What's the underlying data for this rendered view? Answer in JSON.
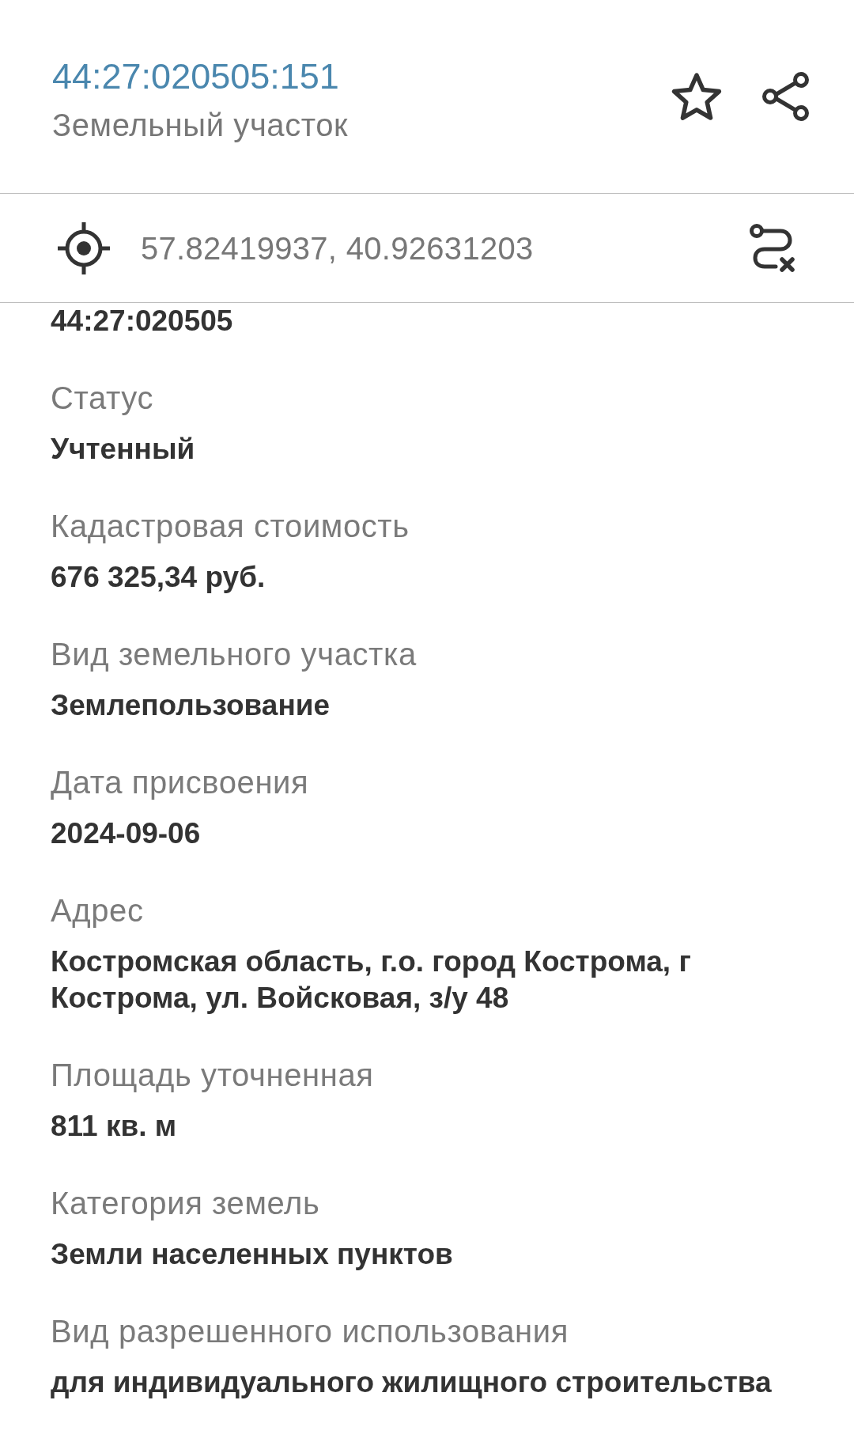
{
  "header": {
    "title": "44:27:020505:151",
    "subtitle": "Земельный участок"
  },
  "location": {
    "coordinates": "57.82419937, 40.92631203"
  },
  "fields": [
    {
      "value": "44:27:020505"
    },
    {
      "label": "Статус",
      "value": "Учтенный"
    },
    {
      "label": "Кадастровая стоимость",
      "value": "676 325,34 руб."
    },
    {
      "label": "Вид земельного участка",
      "value": "Землепользование"
    },
    {
      "label": "Дата присвоения",
      "value": "2024-09-06"
    },
    {
      "label": "Адрес",
      "value": "Костромская область, г.о. город Кострома, г Кострома, ул. Войсковая, з/у 48"
    },
    {
      "label": "Площадь уточненная",
      "value": "811 кв. м"
    },
    {
      "label": "Категория земель",
      "value": "Земли населенных пунктов"
    },
    {
      "label": "Вид разрешенного использования",
      "value": "для индивидуального жилищного строительства"
    }
  ]
}
